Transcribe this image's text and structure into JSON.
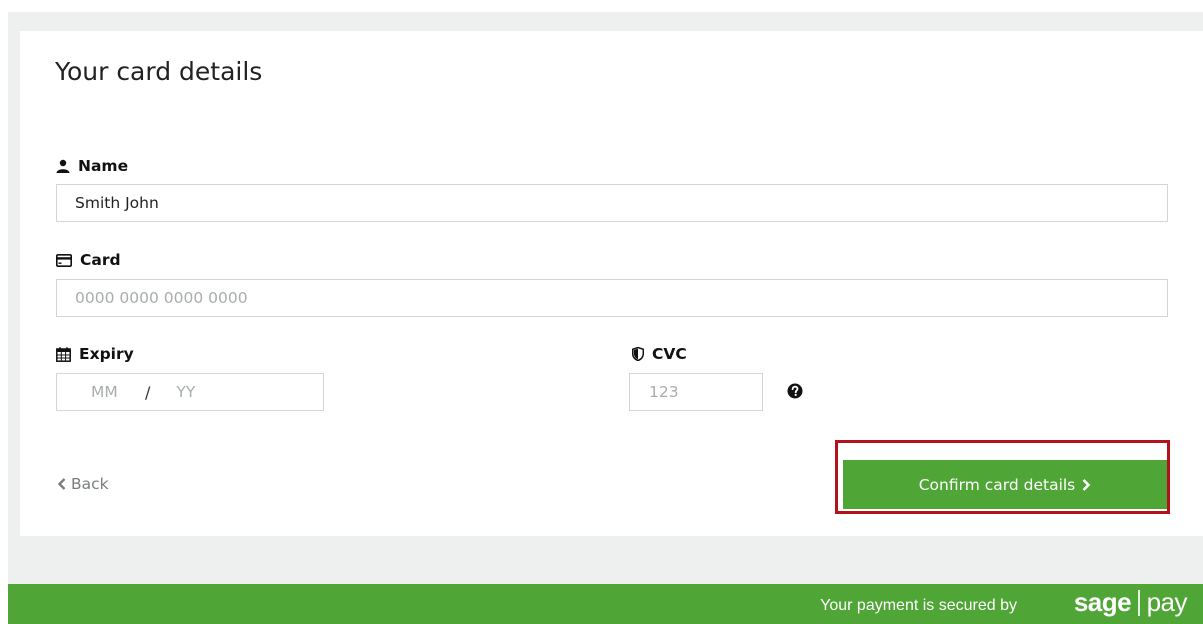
{
  "form": {
    "title": "Your card details",
    "name": {
      "label": "Name",
      "value": "Smith John",
      "icon": "user-icon"
    },
    "card": {
      "label": "Card",
      "placeholder": "0000 0000 0000 0000",
      "value": "",
      "icon": "credit-card-icon"
    },
    "expiry": {
      "label": "Expiry",
      "month_placeholder": "MM",
      "separator": "/",
      "year_placeholder": "YY",
      "icon": "calendar-icon"
    },
    "cvc": {
      "label": "CVC",
      "placeholder": "123",
      "icon": "shield-icon",
      "help_icon": "question-circle-icon"
    }
  },
  "actions": {
    "back_label": "Back",
    "confirm_label": "Confirm card details"
  },
  "footer": {
    "secured_text": "Your payment is secured by",
    "brand_left": "sage",
    "brand_right": "pay"
  },
  "colors": {
    "accent": "#4fa535",
    "highlight": "#b3121c",
    "background": "#eef0f0"
  }
}
